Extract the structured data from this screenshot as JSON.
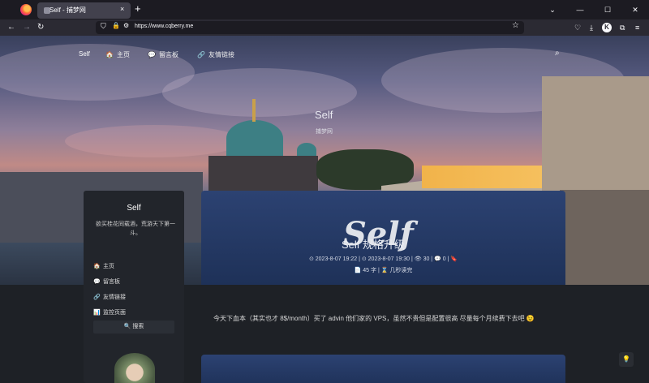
{
  "browser": {
    "tab_title": "Self - 捕梦网",
    "url": "https://www.cqberry.me",
    "new_tab_label": "+",
    "tab_close": "×",
    "controls": {
      "minimize": "—",
      "maximize": "☐",
      "close": "✕",
      "list_tabs": "⌄"
    },
    "nav": {
      "back": "←",
      "forward": "→",
      "reload": "↻"
    },
    "toolbar": {
      "pocket": "♡",
      "downloads": "⤓",
      "extension": "K",
      "extensions_puzzle": "⧉",
      "menu": "≡"
    },
    "url_icons": {
      "shield": "⛉",
      "lock": "🔒",
      "permissions": "⚙",
      "bookmark_star": "☆"
    }
  },
  "site": {
    "nav": {
      "brand": "Self",
      "items": [
        {
          "icon": "🏠",
          "label": "主页"
        },
        {
          "icon": "💬",
          "label": "留言板"
        },
        {
          "icon": "🔗",
          "label": "友情链接"
        }
      ],
      "search_icon": "⌕"
    },
    "hero": {
      "title": "Self",
      "subtitle": "捕梦网"
    },
    "sidebar": {
      "name": "Self",
      "description": "欲买桂花同载酒，荒游天下第一斗。",
      "menu": [
        {
          "icon": "🏠",
          "label": "主页"
        },
        {
          "icon": "💬",
          "label": "留言板"
        },
        {
          "icon": "🔗",
          "label": "友情链接"
        },
        {
          "icon": "📊",
          "label": "监控页面"
        }
      ],
      "search_label": "🔍 搜索"
    },
    "post": {
      "watermark": "Self",
      "title": "Self 规格升级",
      "meta": "⊙ 2023-8-07 19:22 | ⊙ 2023-8-07 19:30 | 👁 30 | 💬 0 | 🔖",
      "meta2": "📄 45 字 | ⌛ 几秒读完",
      "excerpt": "今天下血本（其实也才 8$/month）买了 advin 他们家的 VPS，虽然不贵但是配置很高 尽量每个月续费下去吧 😉"
    },
    "float_button": "💡"
  }
}
